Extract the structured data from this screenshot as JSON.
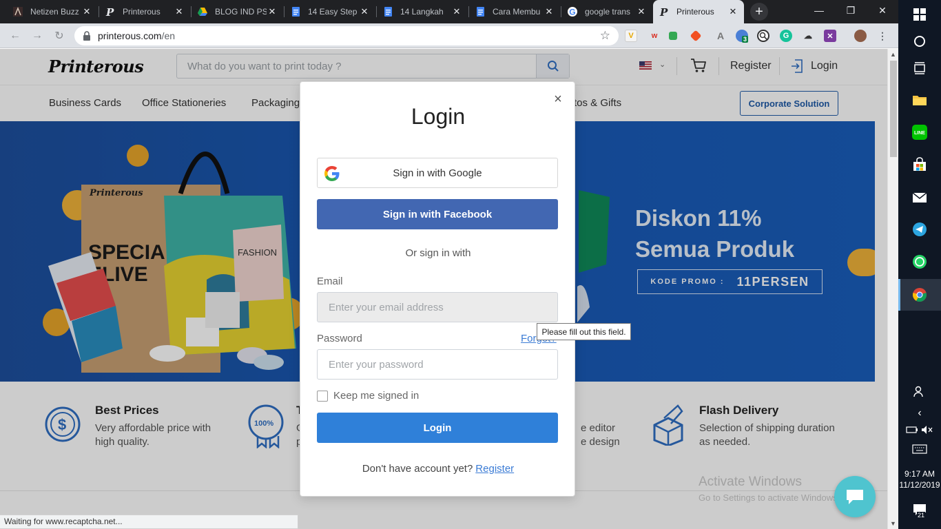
{
  "browser": {
    "tabs": [
      {
        "title": "Netizen Buzz",
        "icon": "netizen-favicon"
      },
      {
        "title": "Printerous",
        "icon": "printerous-favicon"
      },
      {
        "title": "BLOG IND PS",
        "icon": "google-drive-favicon"
      },
      {
        "title": "14 Easy Step",
        "icon": "google-docs-favicon"
      },
      {
        "title": "14 Langkah",
        "icon": "google-docs-favicon"
      },
      {
        "title": "Cara Membu",
        "icon": "google-docs-favicon"
      },
      {
        "title": "google trans",
        "icon": "google-favicon"
      },
      {
        "title": "Printerous",
        "icon": "printerous-favicon",
        "active": true
      }
    ],
    "url_host": "printerous.com",
    "url_path": "/en",
    "extension_badge": "3",
    "status_text": "Waiting for www.recaptcha.net..."
  },
  "site": {
    "logo": "Printerous",
    "search_placeholder": "What do you want to print today ?",
    "register": "Register",
    "login": "Login",
    "categories": [
      "Business Cards",
      "Office Stationeries",
      "Packaging",
      "tos & Gifts"
    ],
    "corporate": "Corporate Solution",
    "promo": {
      "line1": "Diskon 11%",
      "line2": "Semua Produk",
      "code_label": "KODE PROMO :",
      "code": "11PERSEN"
    },
    "features": [
      {
        "title": "Best Prices",
        "desc": "Very affordable price with high quality."
      },
      {
        "title": "T",
        "desc": "G p"
      },
      {
        "title": "",
        "desc": "e editor e design"
      },
      {
        "title": "Flash Delivery",
        "desc": "Selection of shipping duration as needed."
      }
    ]
  },
  "modal": {
    "title": "Login",
    "close": "×",
    "google": "Sign in with Google",
    "facebook": "Sign in with Facebook",
    "or": "Or sign in with",
    "email_label": "Email",
    "email_placeholder": "Enter your email address",
    "password_label": "Password",
    "forgot": "Forgot?",
    "password_placeholder": "Enter your password",
    "keep": "Keep me signed in",
    "login_btn": "Login",
    "no_account": "Don't have account yet?",
    "register_link": "Register"
  },
  "tooltip": "Please fill out this field.",
  "watermark": {
    "line1": "Activate Windows",
    "line2": "Go to Settings to activate Windows."
  },
  "taskbar": {
    "time": "9:17 AM",
    "date": "11/12/2019",
    "notifications": "21"
  },
  "colors": {
    "facebook": "#4267b2",
    "login_button": "#2f80d9",
    "corporate": "#1e5aa8",
    "banner": "#1859b4"
  }
}
